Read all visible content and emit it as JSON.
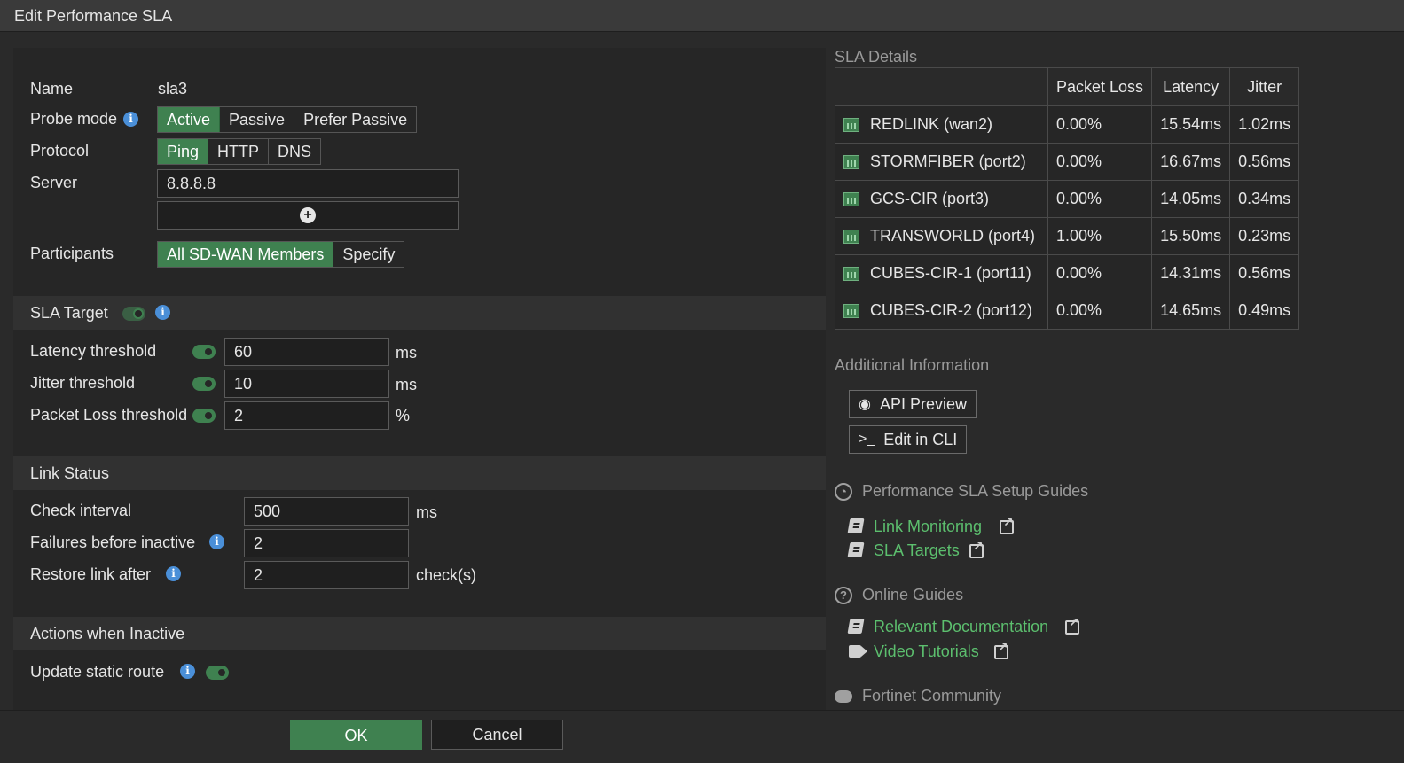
{
  "window": {
    "title": "Edit Performance SLA"
  },
  "form": {
    "name_label": "Name",
    "name_value": "sla3",
    "probe_mode_label": "Probe mode",
    "probe_modes": [
      "Active",
      "Passive",
      "Prefer Passive"
    ],
    "probe_mode_selected": "Active",
    "protocol_label": "Protocol",
    "protocols": [
      "Ping",
      "HTTP",
      "DNS"
    ],
    "protocol_selected": "Ping",
    "server_label": "Server",
    "server_value": "8.8.8.8",
    "participants_label": "Participants",
    "participants_options": [
      "All SD-WAN Members",
      "Specify"
    ],
    "participants_selected": "All SD-WAN Members"
  },
  "sla_target": {
    "title": "SLA Target",
    "latency_label": "Latency threshold",
    "latency_value": "60",
    "latency_unit": "ms",
    "jitter_label": "Jitter threshold",
    "jitter_value": "10",
    "jitter_unit": "ms",
    "packet_loss_label": "Packet Loss threshold",
    "packet_loss_value": "2",
    "packet_loss_unit": "%"
  },
  "link_status": {
    "title": "Link Status",
    "check_interval_label": "Check interval",
    "check_interval_value": "500",
    "check_interval_unit": "ms",
    "failures_label": "Failures before inactive",
    "failures_value": "2",
    "restore_label": "Restore link after",
    "restore_value": "2",
    "restore_unit": "check(s)"
  },
  "actions_inactive": {
    "title": "Actions when Inactive",
    "update_static_route_label": "Update static route"
  },
  "sla_details": {
    "title": "SLA Details",
    "columns": [
      "",
      "Packet Loss",
      "Latency",
      "Jitter"
    ],
    "rows": [
      {
        "name": "REDLINK (wan2)",
        "packet_loss": "0.00%",
        "latency": "15.54ms",
        "jitter": "1.02ms"
      },
      {
        "name": "STORMFIBER (port2)",
        "packet_loss": "0.00%",
        "latency": "16.67ms",
        "jitter": "0.56ms"
      },
      {
        "name": "GCS-CIR (port3)",
        "packet_loss": "0.00%",
        "latency": "14.05ms",
        "jitter": "0.34ms"
      },
      {
        "name": "TRANSWORLD (port4)",
        "packet_loss": "1.00%",
        "latency": "15.50ms",
        "jitter": "0.23ms"
      },
      {
        "name": "CUBES-CIR-1 (port11)",
        "packet_loss": "0.00%",
        "latency": "14.31ms",
        "jitter": "0.56ms"
      },
      {
        "name": "CUBES-CIR-2 (port12)",
        "packet_loss": "0.00%",
        "latency": "14.65ms",
        "jitter": "0.49ms"
      }
    ]
  },
  "additional_info": {
    "title": "Additional Information",
    "api_preview": "API Preview",
    "edit_cli": "Edit in CLI"
  },
  "setup_guides": {
    "title": "Performance SLA Setup Guides",
    "link_monitoring": "Link Monitoring",
    "sla_targets": "SLA Targets"
  },
  "online_guides": {
    "title": "Online Guides",
    "relevant_docs": "Relevant Documentation",
    "video_tutorials": "Video Tutorials"
  },
  "community": {
    "title": "Fortinet Community"
  },
  "footer": {
    "ok": "OK",
    "cancel": "Cancel"
  },
  "colors": {
    "accent": "#3f8150",
    "link": "#5cbf6e",
    "info": "#4a8fd8"
  }
}
